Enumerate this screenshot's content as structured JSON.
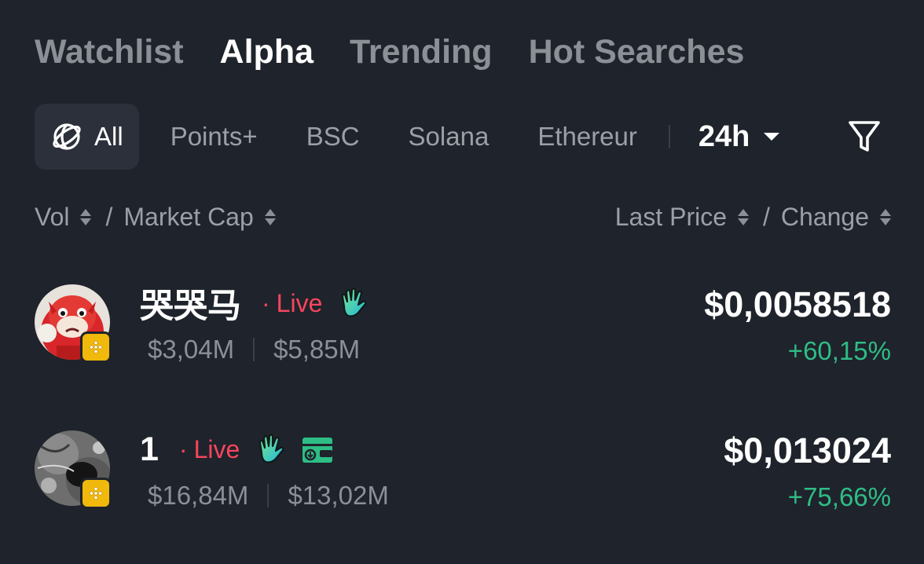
{
  "tabs": {
    "watchlist": "Watchlist",
    "alpha": "Alpha",
    "trending": "Trending",
    "hot_searches": "Hot Searches"
  },
  "filters": {
    "all": "All",
    "points": "Points+",
    "bsc": "BSC",
    "solana": "Solana",
    "ethereum": "Ethereur",
    "timeframe": "24h"
  },
  "sort": {
    "vol": "Vol",
    "market_cap": "Market Cap",
    "last_price": "Last Price",
    "change": "Change",
    "slash": "/"
  },
  "tokens": [
    {
      "name": "哭哭马",
      "live": "Live",
      "volume": "$3,04M",
      "market_cap": "$5,85M",
      "price": "$0,0058518",
      "change": "+60,15%"
    },
    {
      "name": "1",
      "live": "Live",
      "volume": "$16,84M",
      "market_cap": "$13,02M",
      "price": "$0,013024",
      "change": "+75,66%"
    }
  ],
  "colors": {
    "background": "#1f232b",
    "live": "#f6465d",
    "positive": "#2ebd85",
    "bnb_badge": "#f0b90b"
  },
  "icons": {
    "globe": "globe-icon",
    "filter": "filter-icon",
    "hand": "waving-hand-icon",
    "wallet": "wallet-icon",
    "bnb": "bnb-chain-icon"
  }
}
